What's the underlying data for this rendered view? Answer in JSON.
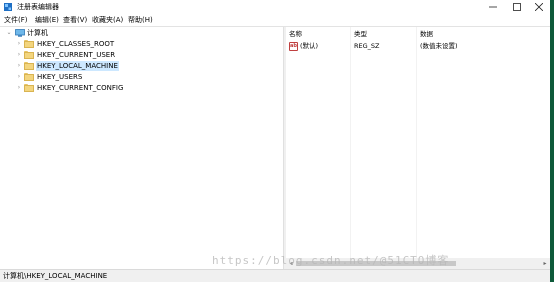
{
  "window": {
    "title": "注册表编辑器",
    "icon": "regedit-icon"
  },
  "menu": [
    "文件(F)",
    "编辑(E)",
    "查看(V)",
    "收藏夹(A)",
    "帮助(H)"
  ],
  "tree": {
    "root": {
      "label": "计算机",
      "icon": "computer-icon",
      "expanded": true
    },
    "keys": [
      {
        "label": "HKEY_CLASSES_ROOT",
        "selected": false
      },
      {
        "label": "HKEY_CURRENT_USER",
        "selected": false
      },
      {
        "label": "HKEY_LOCAL_MACHINE",
        "selected": true
      },
      {
        "label": "HKEY_USERS",
        "selected": false
      },
      {
        "label": "HKEY_CURRENT_CONFIG",
        "selected": false
      }
    ]
  },
  "values_table": {
    "columns": [
      "名称",
      "类型",
      "数据"
    ],
    "rows": [
      {
        "name": "(默认)",
        "type": "REG_SZ",
        "data": "(数值未设置)",
        "icon": "string-value-icon"
      }
    ]
  },
  "status_bar": {
    "path": "计算机\\HKEY_LOCAL_MACHINE"
  },
  "watermark": "https://blog.csdn.net/@51CTO博客",
  "colors": {
    "selection": "#cde8ff",
    "folder": "#f3d57e",
    "frame_edge": "#0e5a3a"
  }
}
